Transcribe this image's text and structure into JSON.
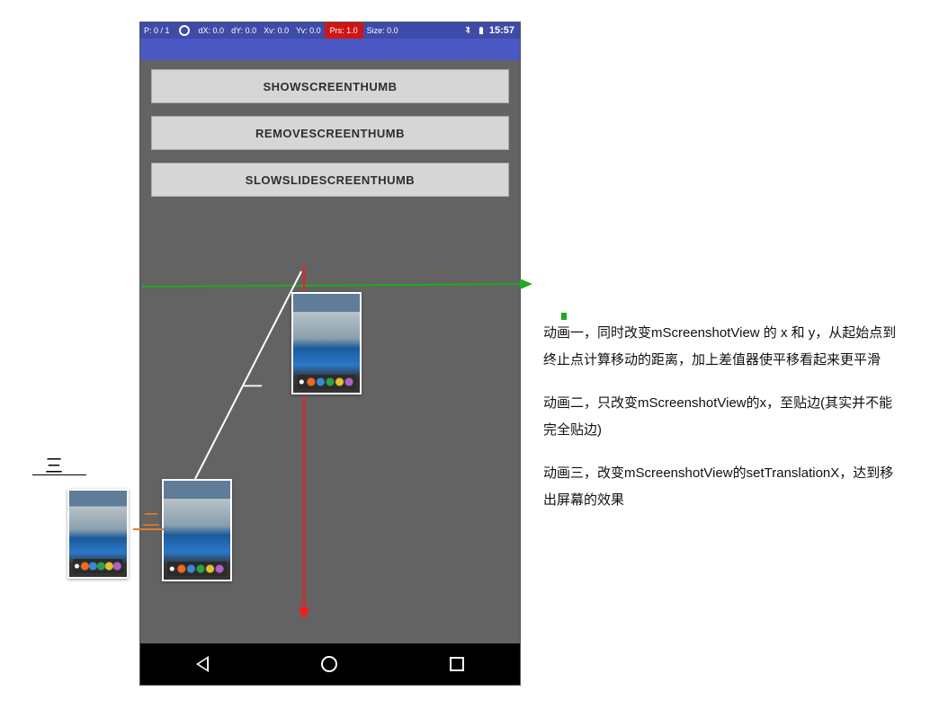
{
  "statusbar": {
    "p": "P: 0 / 1",
    "dx": "dX: 0.0",
    "dy": "dY: 0.0",
    "xv": "Xv: 0.0",
    "yv": "Yv: 0.0",
    "prs": "Prs: 1.0",
    "size": "Size: 0.0",
    "time": "15:57"
  },
  "buttons": {
    "show": "SHOWSCREENTHUMB",
    "remove": "REMOVESCREENTHUMB",
    "slow": "SLOWSLIDESCREENTHUMB"
  },
  "labels": {
    "one": "一",
    "two": "二",
    "three": "三"
  },
  "annotations": {
    "a1": "动画一，同时改变mScreenshotView 的 x 和 y，从起始点到终止点计算移动的距离，加上差值器使平移看起来更平滑",
    "a2": "动画二，只改变mScreenshotView的x，至贴边(其实并不能完全贴边)",
    "a3": "动画三，改变mScreenshotView的setTranslationX，达到移出屏幕的效果"
  }
}
